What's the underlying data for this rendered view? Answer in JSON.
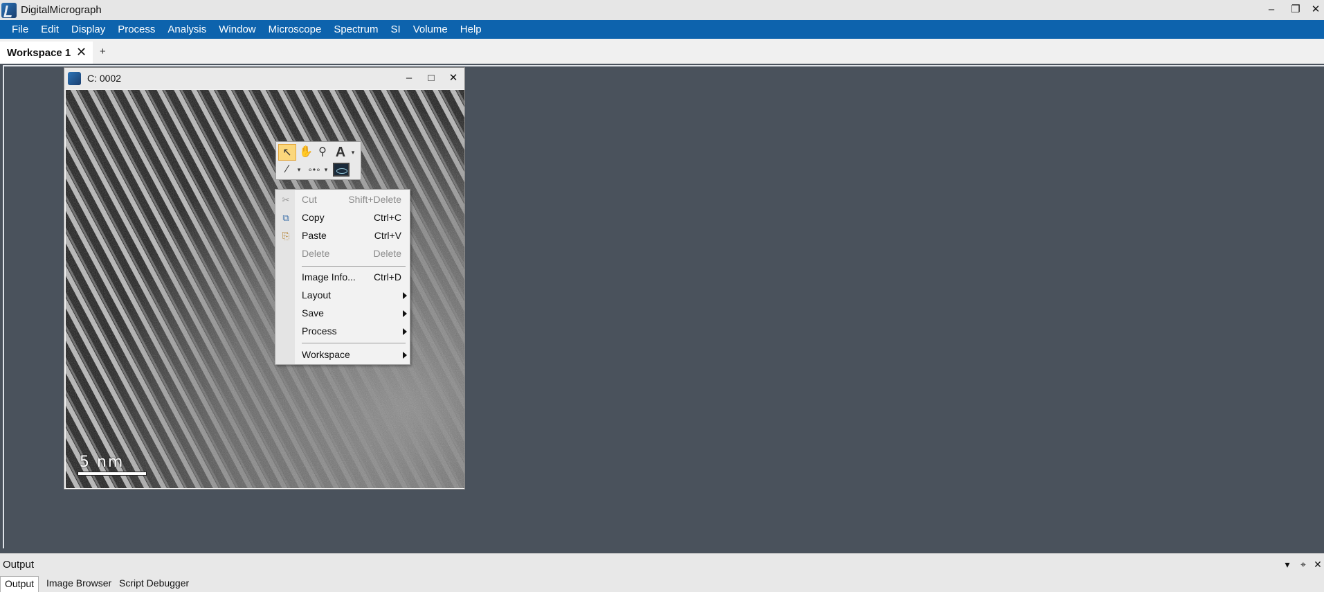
{
  "app": {
    "title": "DigitalMicrograph",
    "icon": "digitalmicrograph-app-icon",
    "window_controls": {
      "minimize": "–",
      "restore": "❐",
      "close": "✕"
    }
  },
  "menubar": {
    "items": [
      "File",
      "Edit",
      "Display",
      "Process",
      "Analysis",
      "Window",
      "Microscope",
      "Spectrum",
      "SI",
      "Volume",
      "Help"
    ],
    "background": "#0d63ad"
  },
  "workspace_tabs": {
    "tabs": [
      {
        "label": "Workspace 1",
        "close": "✕"
      }
    ],
    "add": "+"
  },
  "image_window": {
    "title": "C: 0002",
    "controls": {
      "minimize": "–",
      "maximize": "□",
      "close": "✕"
    },
    "scale_bar_label": "5 nm"
  },
  "tool_palette": {
    "tools": [
      {
        "name": "pointer-tool",
        "icon": "arrow-cursor-icon",
        "glyph": "↖",
        "selected": true
      },
      {
        "name": "hand-tool",
        "icon": "hand-icon",
        "glyph": "✋"
      },
      {
        "name": "zoom-tool",
        "icon": "magnifier-icon",
        "glyph": "⚲"
      },
      {
        "name": "text-tool",
        "icon": "text-a-icon",
        "glyph": "A"
      },
      {
        "name": "line-tool",
        "icon": "dashed-line-icon",
        "glyph": "∕"
      },
      {
        "name": "points-tool",
        "icon": "points-icon",
        "glyph": "∘•∘"
      },
      {
        "name": "roi-tool",
        "icon": "profile-roi-icon"
      }
    ],
    "dropdown_glyph": "▾"
  },
  "context_menu": {
    "items": [
      {
        "label": "Cut",
        "shortcut": "Shift+Delete",
        "enabled": false,
        "icon": "scissors-icon",
        "glyph": "✂"
      },
      {
        "label": "Copy",
        "shortcut": "Ctrl+C",
        "enabled": true,
        "icon": "copy-icon",
        "glyph": "⧉"
      },
      {
        "label": "Paste",
        "shortcut": "Ctrl+V",
        "enabled": true,
        "icon": "paste-icon",
        "glyph": "⎘"
      },
      {
        "label": "Delete",
        "shortcut": "Delete",
        "enabled": false
      },
      {
        "separator": true
      },
      {
        "label": "Image Info...",
        "shortcut": "Ctrl+D",
        "enabled": true
      },
      {
        "label": "Layout",
        "submenu": true,
        "enabled": true
      },
      {
        "label": "Save",
        "submenu": true,
        "enabled": true
      },
      {
        "label": "Process",
        "submenu": true,
        "enabled": true
      },
      {
        "separator": true
      },
      {
        "label": "Workspace",
        "submenu": true,
        "enabled": true
      }
    ]
  },
  "output_panel": {
    "title": "Output",
    "controls": {
      "dropdown": "▾",
      "pin": "⌖",
      "close": "✕"
    },
    "tabs": [
      "Output",
      "Image Browser",
      "Script Debugger"
    ],
    "active_tab": "Output"
  }
}
